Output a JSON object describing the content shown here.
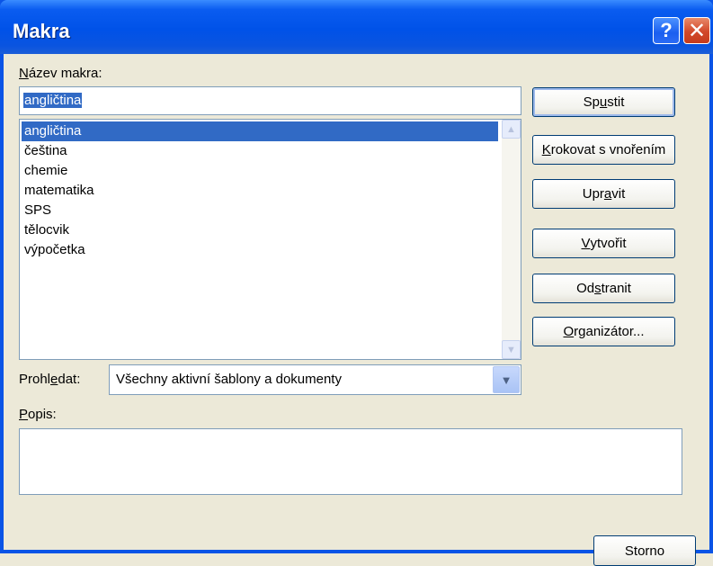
{
  "window": {
    "title": "Makra",
    "help_glyph": "?",
    "close_glyph": "✕"
  },
  "macro_name": {
    "label_key": "N",
    "label_rest": "ázev makra:",
    "value": "angličtina"
  },
  "macros": [
    "angličtina",
    "čeština",
    "chemie",
    "matematika",
    "SPS",
    "tělocvik",
    "výpočetka"
  ],
  "selected_macro_index": 0,
  "buttons": {
    "run": {
      "pre": "Sp",
      "key": "u",
      "post": "stit"
    },
    "step": {
      "pre": "",
      "key": "K",
      "post": "rokovat s vnořením"
    },
    "edit": {
      "pre": "Upr",
      "key": "a",
      "post": "vit"
    },
    "create": {
      "pre": "",
      "key": "V",
      "post": "ytvořit"
    },
    "delete": {
      "pre": "Od",
      "key": "s",
      "post": "tranit"
    },
    "organizer": {
      "pre": "",
      "key": "O",
      "post": "rganizátor..."
    },
    "cancel": "Storno"
  },
  "search": {
    "label_pre": "Prohl",
    "label_key": "e",
    "label_post": "dat:",
    "value": "Všechny aktivní šablony a dokumenty"
  },
  "description": {
    "label_key": "P",
    "label_rest": "opis:",
    "value": ""
  },
  "colors": {
    "titlebar": "#0a54e6",
    "selection": "#316ac5",
    "face": "#ece9d8"
  }
}
